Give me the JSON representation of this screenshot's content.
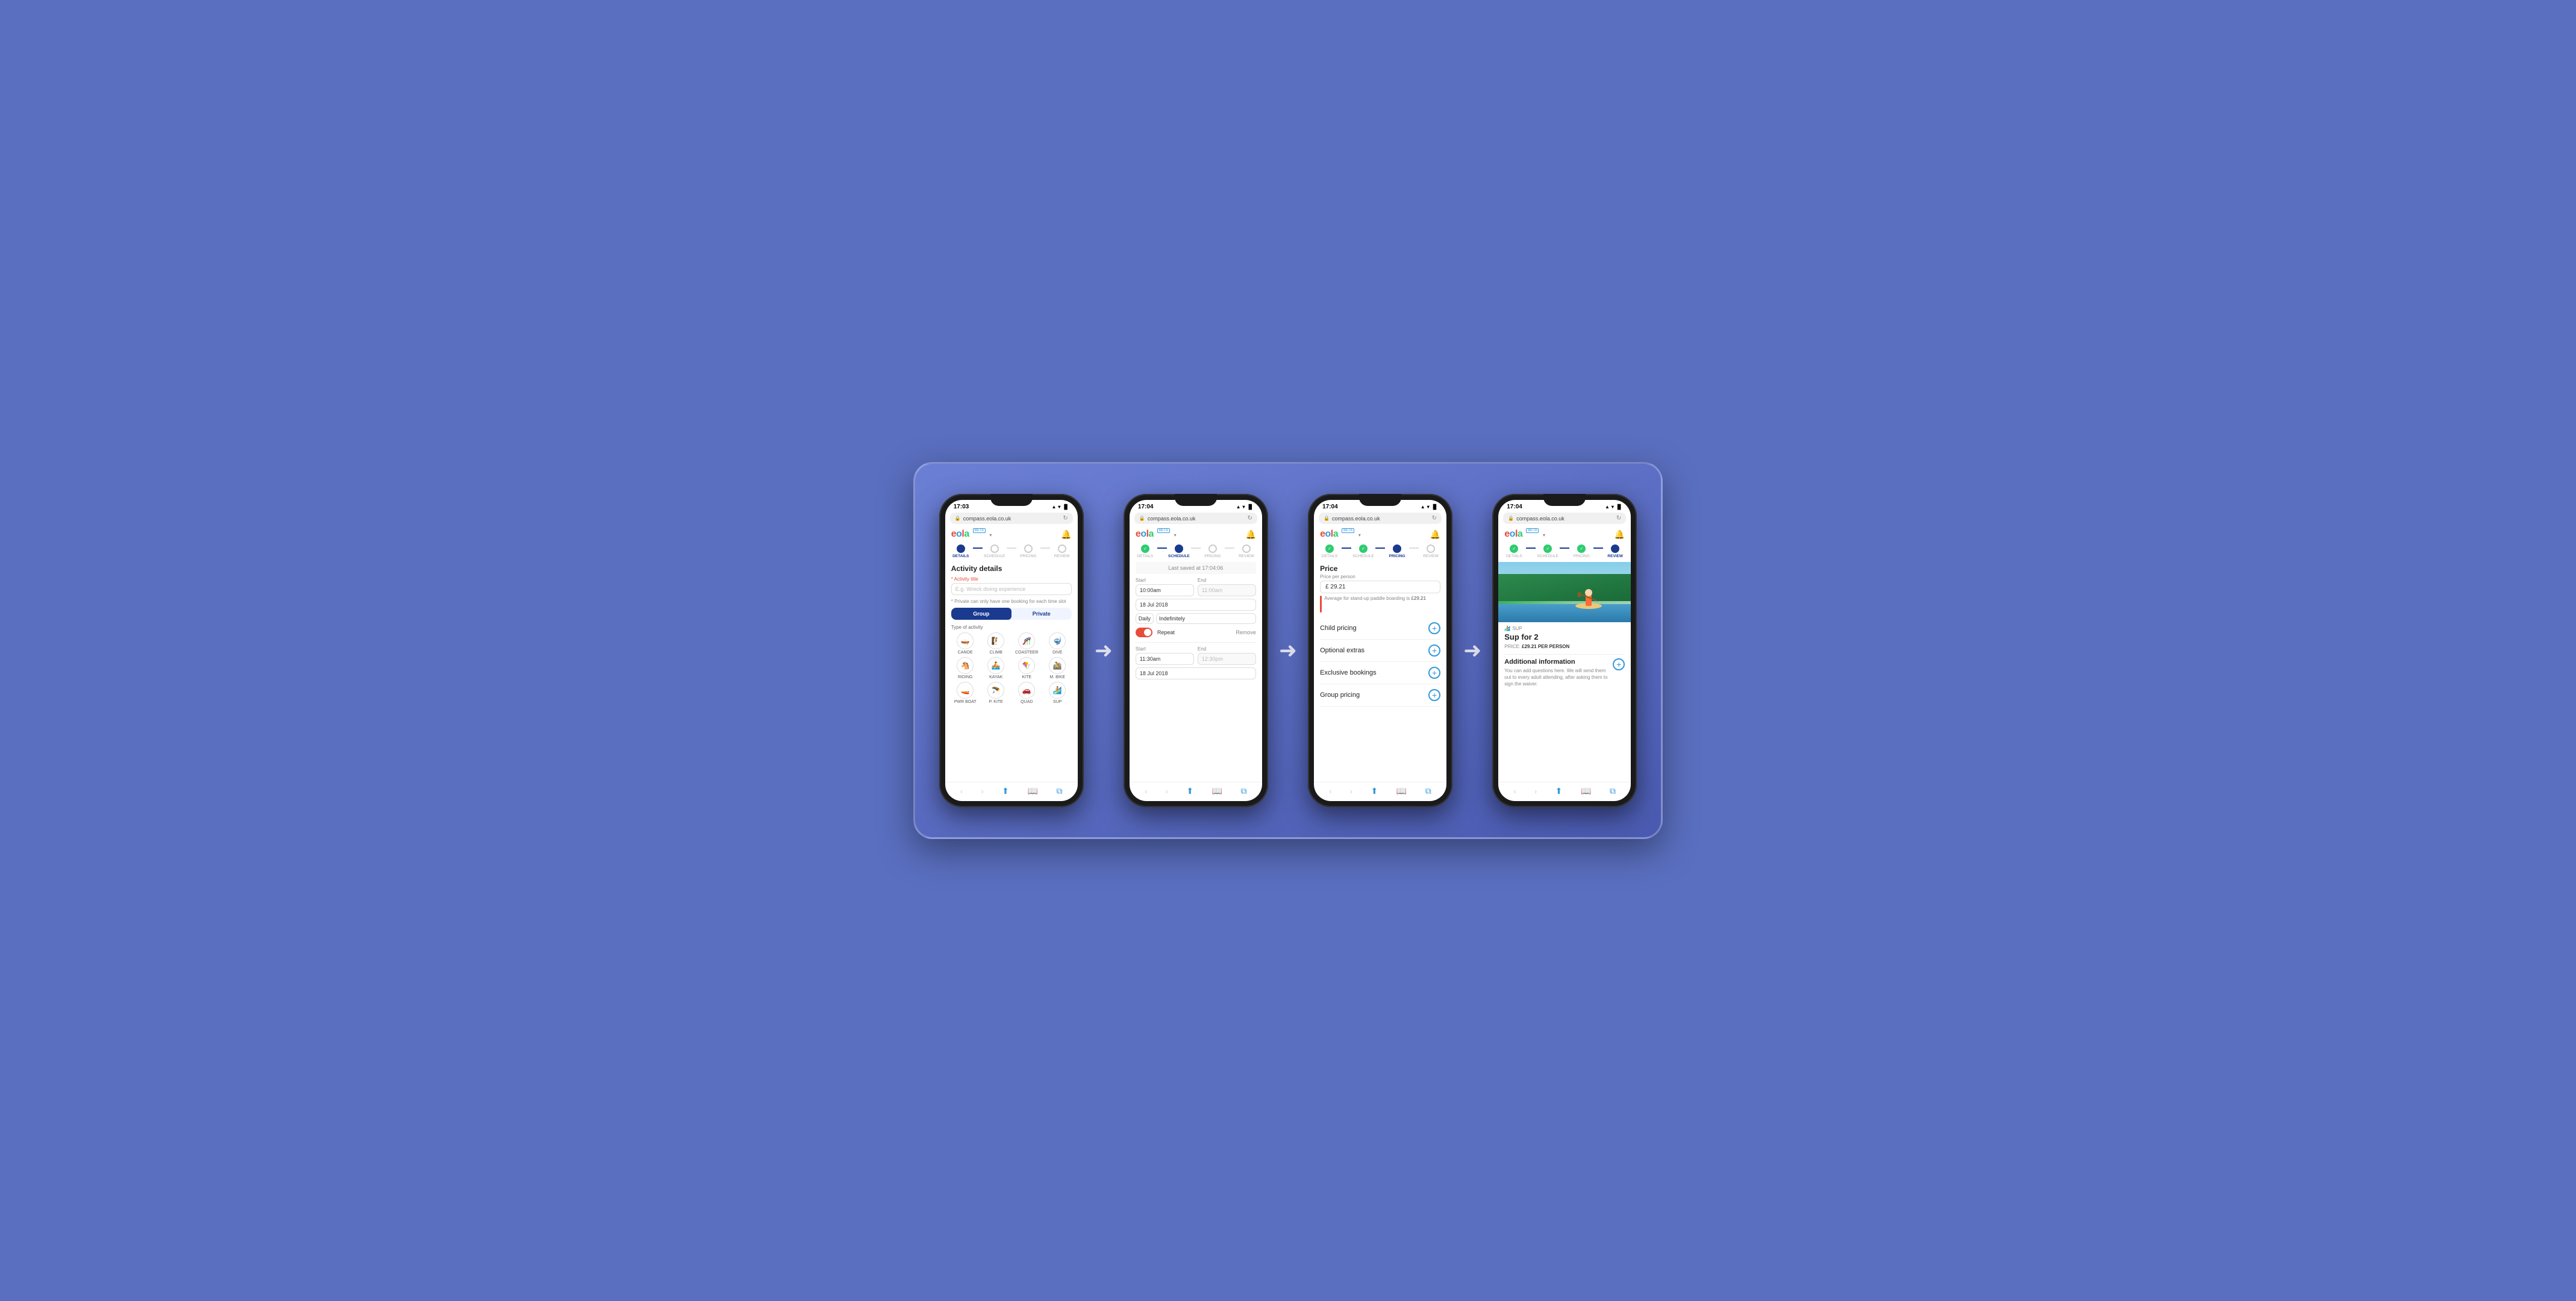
{
  "background": "#5a6fc0",
  "phones": [
    {
      "id": "phone1",
      "statusBar": {
        "time": "17:03",
        "icons": "▲ ▌▌▌ ▐▌"
      },
      "urlBar": {
        "url": "compass.eola.co.uk"
      },
      "steps": [
        {
          "label": "DETAILS",
          "state": "active"
        },
        {
          "label": "SCHEDULE",
          "state": "inactive"
        },
        {
          "label": "PRICING",
          "state": "inactive"
        },
        {
          "label": "REVIEW",
          "state": "inactive"
        }
      ],
      "screen": "activity-details",
      "content": {
        "title": "Activity details",
        "fieldLabel": "* Activity title",
        "fieldPlaceholder": "E.g. Wreck diving experience",
        "note": "* Private can only have one booking for each time slot",
        "groupLabel": "Group",
        "privateLabel": "Private",
        "typeLabel": "Type of activity",
        "activities": [
          {
            "icon": "✏️",
            "label": "CANOE"
          },
          {
            "icon": "🧗",
            "label": "CLIMB"
          },
          {
            "icon": "🎢",
            "label": "COASTEER"
          },
          {
            "icon": "🤿",
            "label": "DIVE"
          },
          {
            "icon": "🐴",
            "label": "RIDING"
          },
          {
            "icon": "🛶",
            "label": "KAYAK"
          },
          {
            "icon": "🪁",
            "label": "KITE"
          },
          {
            "icon": "🚵",
            "label": "M. BIKE"
          },
          {
            "icon": "🚤",
            "label": "PWR BOAT"
          },
          {
            "icon": "🪂",
            "label": "P. KITE"
          },
          {
            "icon": "🚗",
            "label": "QUAD"
          },
          {
            "icon": "🏄",
            "label": "SUP"
          }
        ]
      }
    },
    {
      "id": "phone2",
      "statusBar": {
        "time": "17:04",
        "icons": "▲ ▌▌▌ ▐▌"
      },
      "urlBar": {
        "url": "compass.eola.co.uk"
      },
      "steps": [
        {
          "label": "DETAILS",
          "state": "done"
        },
        {
          "label": "SCHEDULE",
          "state": "active"
        },
        {
          "label": "PRICING",
          "state": "inactive"
        },
        {
          "label": "REVIEW",
          "state": "inactive"
        }
      ],
      "screen": "schedule",
      "content": {
        "savedBanner": "Last saved at 17:04:06",
        "slot1": {
          "startLabel": "Start",
          "startValue": "10:00am",
          "endLabel": "End",
          "endValue": "11:00am",
          "date": "18 Jul 2018",
          "repeatType": "Daily",
          "repeatDuration": "Indefinitely",
          "repeatLabel": "Repeat",
          "removeLabel": "Remove"
        },
        "slot2": {
          "startLabel": "Start",
          "startValue": "11:30am",
          "endLabel": "End",
          "endValue": "12:30pm",
          "date": "18 Jul 2018"
        }
      }
    },
    {
      "id": "phone3",
      "statusBar": {
        "time": "17:04",
        "icons": "▲ ▌▌▌ ▐▌"
      },
      "urlBar": {
        "url": "compass.eola.co.uk"
      },
      "steps": [
        {
          "label": "DETAILS",
          "state": "done"
        },
        {
          "label": "SCHEDULE",
          "state": "done"
        },
        {
          "label": "PRICING",
          "state": "active"
        },
        {
          "label": "REVIEW",
          "state": "inactive"
        }
      ],
      "screen": "pricing",
      "content": {
        "priceTitle": "Price",
        "pricePerPersonLabel": "Price per person",
        "priceValue": "£ 29.21",
        "avgText": "Average for stand-up paddle boarding is",
        "avgPrice": "£29.21",
        "rows": [
          {
            "label": "Child pricing"
          },
          {
            "label": "Optional extras"
          },
          {
            "label": "Exclusive bookings"
          },
          {
            "label": "Group pricing"
          }
        ]
      }
    },
    {
      "id": "phone4",
      "statusBar": {
        "time": "17:04",
        "icons": "▲ ▌▌▌ ▐▌"
      },
      "urlBar": {
        "url": "compass.eola.co.uk"
      },
      "steps": [
        {
          "label": "DETAILS",
          "state": "done"
        },
        {
          "label": "SCHEDULE",
          "state": "done"
        },
        {
          "label": "PRICING",
          "state": "done"
        },
        {
          "label": "REVIEW",
          "state": "active"
        }
      ],
      "screen": "review",
      "content": {
        "badge": "SUP",
        "title": "Sup for 2",
        "priceLabel": "PRICE:",
        "priceValue": "£29.21 PER PERSON",
        "additionalTitle": "Additional information",
        "additionalText": "You can add questions here. We will send them out to every adult attending, after asking them to sign the waiver."
      }
    }
  ],
  "arrows": [
    "→",
    "→",
    "→"
  ]
}
